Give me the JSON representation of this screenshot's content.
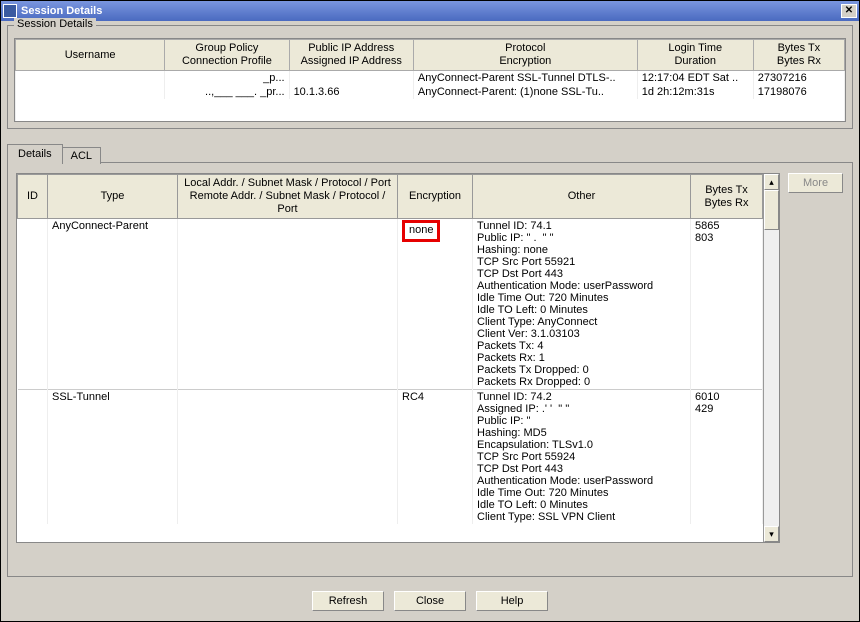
{
  "window": {
    "title": "Session Details"
  },
  "groupbox_label": "Session Details",
  "summary": {
    "headers": {
      "c1a": "Username",
      "c1b": "",
      "c2a": "Group Policy",
      "c2b": "Connection Profile",
      "c3a": "Public IP Address",
      "c3b": "Assigned IP Address",
      "c4a": "Protocol",
      "c4b": "Encryption",
      "c5a": "Login Time",
      "c5b": "Duration",
      "c6a": "Bytes Tx",
      "c6b": "Bytes Rx"
    },
    "row1": {
      "c1": "",
      "c2": "_p...",
      "c3": "",
      "c4": "AnyConnect-Parent SSL-Tunnel DTLS-..",
      "c5": "12:17:04 EDT Sat ..",
      "c6": "27307216"
    },
    "row2": {
      "c1": "",
      "c2": "..,___ ___. _pr...",
      "c3": "10.1.3.66",
      "c4": "AnyConnect-Parent: (1)none  SSL-Tu..",
      "c5": "1d 2h:12m:31s",
      "c6": "17198076"
    }
  },
  "tabs": {
    "details": "Details",
    "acl": "ACL"
  },
  "details": {
    "headers": {
      "id": "ID",
      "type": "Type",
      "addr_a": "Local Addr. / Subnet Mask / Protocol / Port",
      "addr_b": "Remote Addr. / Subnet Mask / Protocol / Port",
      "encryption": "Encryption",
      "other": "Other",
      "bytes_a": "Bytes Tx",
      "bytes_b": "Bytes Rx"
    },
    "rows": [
      {
        "id": "",
        "type": "AnyConnect-Parent",
        "addr": "",
        "encryption": "none",
        "other": "Tunnel ID: 74.1\nPublic IP: \" .  \" \"\nHashing: none\nTCP Src Port 55921\nTCP Dst Port 443\nAuthentication Mode: userPassword\nIdle Time Out: 720 Minutes\nIdle TO Left: 0 Minutes\nClient Type: AnyConnect\nClient Ver: 3.1.03103\nPackets Tx: 4\nPackets Rx: 1\nPackets Tx Dropped: 0\nPackets Rx Dropped: 0",
        "bytes_tx": "5865",
        "bytes_rx": "803",
        "highlight_encryption": true
      },
      {
        "id": "",
        "type": "SSL-Tunnel",
        "addr": "",
        "encryption": "RC4",
        "other": "Tunnel ID: 74.2\nAssigned IP: .' '  \" ''\nPublic IP: \"\nHashing: MD5\nEncapsulation: TLSv1.0\nTCP Src Port 55924\nTCP Dst Port 443\nAuthentication Mode: userPassword\nIdle Time Out: 720 Minutes\nIdle TO Left: 0 Minutes\nClient Type: SSL VPN Client",
        "bytes_tx": "6010",
        "bytes_rx": "429",
        "highlight_encryption": false
      }
    ]
  },
  "buttons": {
    "more": "More",
    "refresh": "Refresh",
    "close": "Close",
    "help": "Help"
  }
}
